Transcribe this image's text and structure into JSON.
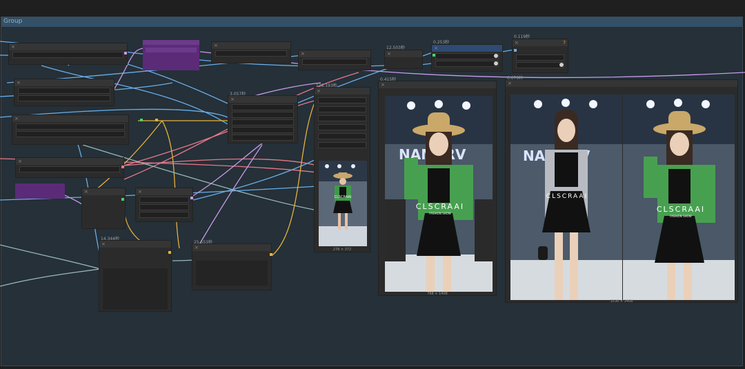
{
  "group": {
    "title": "Group"
  },
  "timings": {
    "t1": "12.503秒",
    "t2": "0.253秒",
    "t3": "0.119秒",
    "t4": "0.415秒",
    "t5": "0.070秒",
    "t6": "128.193秒",
    "t7": "3.057秒",
    "t8": "14.344秒",
    "t9": "25.553秒"
  },
  "previews": {
    "small": {
      "caption": "278 × 372",
      "banner": "CLSCRAAI"
    },
    "single": {
      "caption": "768 × 1408",
      "banner": "CLSCRAAI",
      "sub": "FASHION SHOW",
      "backdrop": "NAMSRV"
    },
    "pair": {
      "caption": "1536 × 1408",
      "banner": "CLSCRAAI",
      "sub": "FASHION SHOW",
      "backdrop": "NAMSRV"
    }
  },
  "icons": {
    "close": "close-icon",
    "warning": "warning-icon"
  },
  "colors": {
    "canvas": "#253038",
    "group_header": "#335066",
    "node": "#2b2b2b",
    "purple_node": "#5b2b78",
    "wire_blue": "#6aaee8",
    "wire_pink": "#e8788a",
    "wire_yellow": "#e8b23a",
    "wire_lavender": "#c79be8",
    "wire_grey": "#9ab8b8"
  }
}
